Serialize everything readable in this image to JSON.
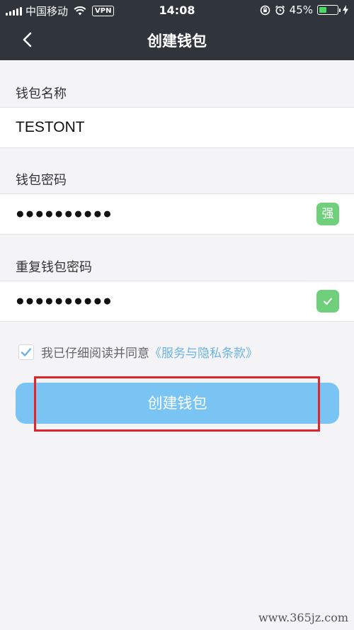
{
  "status_bar": {
    "carrier": "中国移动",
    "vpn": "VPN",
    "time": "14:08",
    "battery": "45%",
    "battery_level": 0.45
  },
  "header": {
    "title": "创建钱包",
    "back_icon": "chevron-left-icon"
  },
  "form": {
    "wallet_name_label": "钱包名称",
    "wallet_name_value": "TESTONT",
    "password_label": "钱包密码",
    "password_value": "●●●●●●●●●●",
    "strength_badge": "强",
    "repeat_password_label": "重复钱包密码",
    "repeat_password_value": "●●●●●●●●●●"
  },
  "agreement": {
    "checked": true,
    "text": "我已仔细阅读并同意",
    "link": "《服务与隐私条款》"
  },
  "create_button": "创建钱包",
  "watermark": "www.365jz.com",
  "colors": {
    "header_bg": "#2f353b",
    "button_bg": "#79c4f2",
    "badge_green": "#6fcf7b",
    "link_blue": "#6cb3e3",
    "highlight_red": "#e0242b"
  }
}
